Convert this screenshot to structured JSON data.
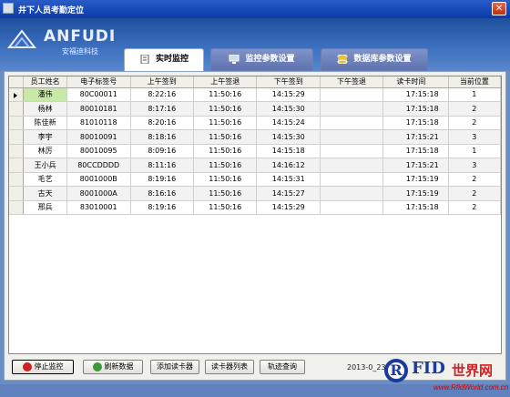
{
  "window": {
    "title": "井下人员考勤定位"
  },
  "logo": {
    "brand": "ANFUDI",
    "sub": "安福迪科技"
  },
  "tabs": [
    {
      "label": "实时监控"
    },
    {
      "label": "监控参数设置"
    },
    {
      "label": "数据库参数设置"
    }
  ],
  "table": {
    "headers": [
      "员工姓名",
      "电子标签号",
      "上午签到",
      "上午签退",
      "下午签到",
      "下午签退",
      "读卡时间",
      "当前位置"
    ],
    "rows": [
      [
        "潘伟",
        "80C00011",
        "8:22:16",
        "11:50:16",
        "14:15:29",
        "",
        "17:15:18",
        "1"
      ],
      [
        "杨林",
        "80010181",
        "8:17:16",
        "11:50:16",
        "14:15:30",
        "",
        "17:15:18",
        "2"
      ],
      [
        "陈佳新",
        "81010118",
        "8:20:16",
        "11:50:16",
        "14:15:24",
        "",
        "17:15:18",
        "2"
      ],
      [
        "李宇",
        "80010091",
        "8:18:16",
        "11:50:16",
        "14:15:30",
        "",
        "17:15:21",
        "3"
      ],
      [
        "林厉",
        "80010095",
        "8:09:16",
        "11:50:16",
        "14:15:18",
        "",
        "17:15:18",
        "1"
      ],
      [
        "王小兵",
        "80CCDDDD",
        "8:11:16",
        "11:50:16",
        "14:16:12",
        "",
        "17:15:21",
        "3"
      ],
      [
        "毛艺",
        "8001000B",
        "8:19:16",
        "11:50:16",
        "14:15:31",
        "",
        "17:15:19",
        "2"
      ],
      [
        "古天",
        "8001000A",
        "8:16:16",
        "11:50:16",
        "14:15:27",
        "",
        "17:15:19",
        "2"
      ],
      [
        "邢兵",
        "83010001",
        "8:19:16",
        "11:50:16",
        "14:15:29",
        "",
        "17:15:18",
        "2"
      ]
    ]
  },
  "buttons": {
    "stop": "停止监控",
    "refresh": "刷新数据",
    "add_reader": "添加读卡器",
    "reader_list": "读卡器列表",
    "track": "轨迹查询"
  },
  "status": {
    "datetime": "2013-0_23"
  },
  "watermark": {
    "r": "R",
    "fid": "FID",
    "cn": "世界网",
    "url": "www.RfidWorld.com.cn"
  },
  "colors": {
    "selected_cell": "#c8e8a8",
    "title_bar": "#0a3aa8",
    "header_bg": "#3f72c0"
  },
  "icons": {
    "stop": "stop-icon",
    "refresh": "refresh-icon",
    "monitor": "monitor-icon",
    "database": "database-icon"
  }
}
